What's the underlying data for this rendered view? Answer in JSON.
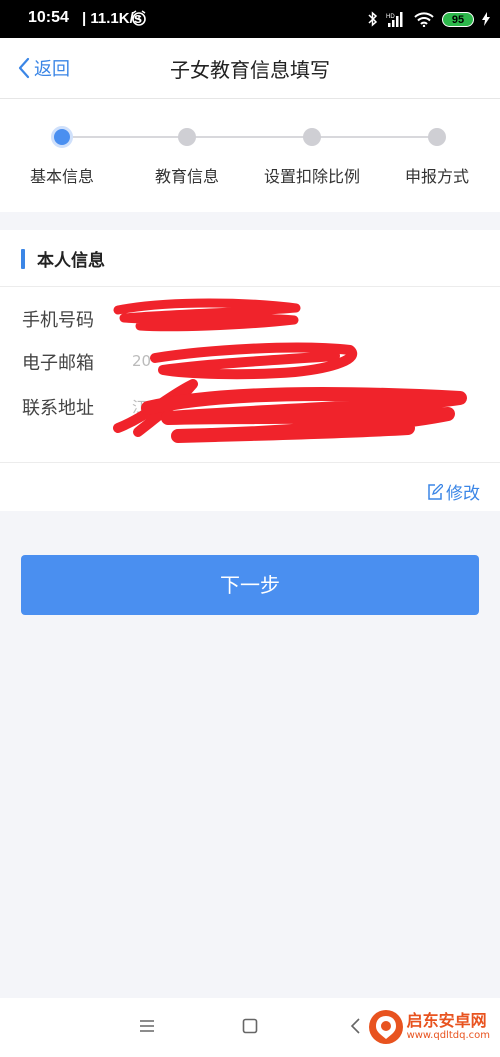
{
  "status_bar": {
    "time": "10:54",
    "network_speed": "| 11.1K/s",
    "battery": "95",
    "icons": [
      "alarm-icon",
      "bluetooth-icon",
      "signal-icon",
      "wifi-icon",
      "battery-icon",
      "charging-icon"
    ]
  },
  "nav": {
    "back_label": "返回",
    "title": "子女教育信息填写"
  },
  "steps": [
    {
      "label": "基本信息",
      "active": true
    },
    {
      "label": "教育信息",
      "active": false
    },
    {
      "label": "设置扣除比例",
      "active": false
    },
    {
      "label": "申报方式",
      "active": false
    }
  ],
  "card": {
    "title": "本人信息",
    "rows": [
      {
        "label": "手机号码",
        "value": ""
      },
      {
        "label": "电子邮箱",
        "value": "20"
      },
      {
        "label": "联系地址",
        "value": "江"
      }
    ],
    "edit_label": "修改"
  },
  "next_button": "下一步",
  "colors": {
    "accent": "#4a8ff0",
    "link": "#3b86e6",
    "redaction": "#f0232b"
  },
  "watermark": {
    "name": "启东安卓网",
    "url": "www.qdltdq.com"
  }
}
